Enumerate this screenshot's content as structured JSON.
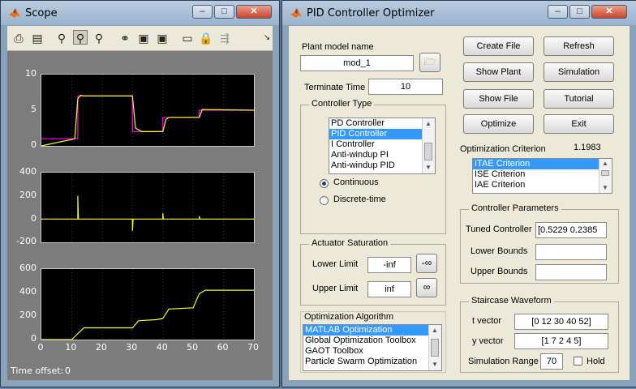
{
  "scope": {
    "title": "Scope",
    "toolbar_icons": [
      "print-icon",
      "parameters-icon",
      "zoom-icon",
      "zoom-x-icon",
      "zoom-y-icon",
      "binoculars-icon",
      "save-axes-icon",
      "restore-axes-icon",
      "floating-scope-icon",
      "lock-icon",
      "signal-selector-icon",
      "menu-arrow-icon"
    ],
    "time_offset_label": "Time offset:",
    "time_offset_value": "0",
    "plot1_yticks": [
      "10",
      "5",
      "0"
    ],
    "plot2_yticks": [
      "400",
      "200",
      "0",
      "-200"
    ],
    "plot3_yticks": [
      "600",
      "400",
      "200",
      "0"
    ],
    "xticks": [
      "0",
      "10",
      "20",
      "30",
      "40",
      "50",
      "60",
      "70"
    ]
  },
  "chart_data": [
    {
      "type": "line",
      "xlim": [
        0,
        70
      ],
      "ylim": [
        0,
        10
      ],
      "series": [
        {
          "color": "#ff00ff",
          "x": [
            0,
            12,
            12,
            30,
            30,
            40,
            40,
            52,
            52,
            70
          ],
          "y": [
            1,
            1,
            7,
            7,
            2,
            2,
            4,
            4,
            5,
            5
          ]
        },
        {
          "color": "#ffff00",
          "x": [
            0,
            11,
            12,
            13,
            14,
            30,
            31,
            33,
            40,
            41,
            42,
            52,
            53,
            70
          ],
          "y": [
            0,
            1,
            6.6,
            7.1,
            7,
            7,
            2.5,
            2,
            2,
            3.7,
            4,
            4,
            5.1,
            5
          ]
        }
      ]
    },
    {
      "type": "line",
      "xlim": [
        0,
        70
      ],
      "ylim": [
        -200,
        400
      ],
      "series": [
        {
          "color": "#ffff00",
          "x": [
            0,
            12,
            12,
            12.2,
            30,
            30,
            30.2,
            40,
            40,
            40.2,
            52,
            52,
            52.2,
            70
          ],
          "y": [
            0,
            0,
            200,
            0,
            0,
            -100,
            0,
            0,
            50,
            0,
            0,
            25,
            0,
            0
          ]
        }
      ]
    },
    {
      "type": "line",
      "xlim": [
        0,
        70
      ],
      "ylim": [
        0,
        600
      ],
      "series": [
        {
          "color": "#ffff00",
          "x": [
            0,
            10,
            12,
            14,
            30,
            32,
            38,
            40,
            42,
            50,
            52,
            54,
            70
          ],
          "y": [
            0,
            0,
            50,
            100,
            100,
            160,
            170,
            180,
            260,
            270,
            390,
            420,
            420
          ]
        }
      ]
    }
  ],
  "pid": {
    "title": "PID Controller Optimizer",
    "plant_model_label": "Plant model name",
    "plant_model_value": "mod_1",
    "terminate_time_label": "Terminate Time",
    "terminate_time_value": "10",
    "buttons": {
      "create_file": "Create File",
      "refresh": "Refresh",
      "show_plant": "Show Plant",
      "simulation": "Simulation",
      "show_file": "Show File",
      "tutorial": "Tutorial",
      "optimize": "Optimize",
      "exit": "Exit"
    },
    "controller_type": {
      "title": "Controller Type",
      "items": [
        "PD Controller",
        "PID Controller",
        "I Controller",
        "Anti-windup PI",
        "Anti-windup PID"
      ],
      "selected_index": 1,
      "continuous_label": "Continuous",
      "discrete_label": "Discrete-time",
      "mode": "continuous"
    },
    "actuator": {
      "title": "Actuator Saturation",
      "lower_label": "Lower Limit",
      "lower_value": "-inf",
      "lower_btn": "-∞",
      "upper_label": "Upper Limit",
      "upper_value": "inf",
      "upper_btn": "∞"
    },
    "algorithm": {
      "title": "Optimization Algorithm",
      "items": [
        "MATLAB Optimization",
        "Global Optimization Toolbox",
        "GAOT Toolbox",
        "Particle Swarm Optimization"
      ],
      "selected_index": 0
    },
    "criterion": {
      "label": "Optimization Criterion",
      "value": "1.1983",
      "items": [
        "ITAE Criterion",
        "ISE Criterion",
        "IAE Criterion"
      ],
      "selected_index": 0
    },
    "params": {
      "title": "Controller Parameters",
      "tuned_label": "Tuned Controller",
      "tuned_value": "[0.5229    0.2385",
      "lower_label": "Lower Bounds",
      "lower_value": "",
      "upper_label": "Upper Bounds",
      "upper_value": ""
    },
    "staircase": {
      "title": "Staircase Waveform",
      "t_label": "t vector",
      "t_value": "[0 12 30 40 52]",
      "y_label": "y vector",
      "y_value": "[1 7 2 4 5]",
      "range_label": "Simulation Range",
      "range_value": "70",
      "hold_label": "Hold",
      "hold_checked": false
    }
  }
}
